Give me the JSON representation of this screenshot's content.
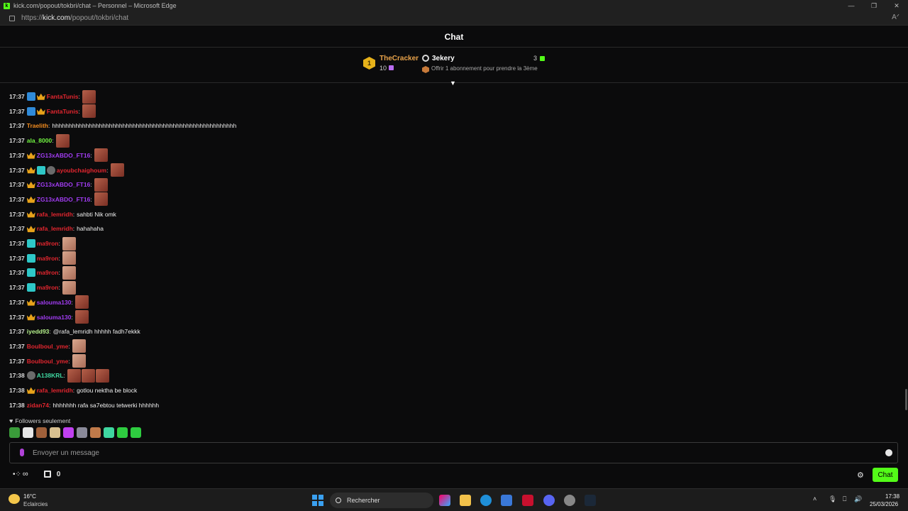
{
  "window": {
    "title": "kick.com/popout/tokbri/chat – Personnel – Microsoft Edge",
    "url_prefix": "https://",
    "url_host": "kick.com",
    "url_path": "/popout/tokbri/chat"
  },
  "header": {
    "title": "Chat"
  },
  "leaderboard": {
    "rank": "1",
    "first_name": "TheCracker",
    "first_count": "10",
    "second_name": "3ekery",
    "second_count": "3",
    "hint": "Offrir 1 abonnement pour prendre la 3ème"
  },
  "messages": [
    {
      "time": "17:37",
      "badges": [
        "sub",
        "vip"
      ],
      "user": "FantaTunis",
      "color": "#e3262f",
      "text": "",
      "emotes": 1,
      "emote_style": "dark"
    },
    {
      "time": "17:37",
      "badges": [
        "sub",
        "vip"
      ],
      "user": "FantaTunis",
      "color": "#e3262f",
      "text": "",
      "emotes": 1,
      "emote_style": "dark"
    },
    {
      "time": "17:37",
      "badges": [],
      "user": "Traelith",
      "color": "#f28c1f",
      "text": "hhhhhhhhhhhhhhhhhhhhhhhhhhhhhhhhhhhhhhhhhhhhhhhhhhhhhhh",
      "emotes": 0,
      "emote_style": "dark"
    },
    {
      "time": "17:37",
      "badges": [],
      "user": "ala_8000",
      "color": "#72f542",
      "text": "",
      "emotes": 1,
      "emote_style": "dark"
    },
    {
      "time": "17:37",
      "badges": [
        "vip"
      ],
      "user": "ZG13xABDO_FT16",
      "color": "#a13cf2",
      "text": "",
      "emotes": 1,
      "emote_style": "dark"
    },
    {
      "time": "17:37",
      "badges": [
        "vip",
        "og",
        "av"
      ],
      "user": "ayoubchaighoum",
      "color": "#e3262f",
      "text": "",
      "emotes": 1,
      "emote_style": "dark"
    },
    {
      "time": "17:37",
      "badges": [
        "vip"
      ],
      "user": "ZG13xABDO_FT16",
      "color": "#a13cf2",
      "text": "",
      "emotes": 1,
      "emote_style": "dark"
    },
    {
      "time": "17:37",
      "badges": [
        "vip"
      ],
      "user": "ZG13xABDO_FT16",
      "color": "#a13cf2",
      "text": "",
      "emotes": 1,
      "emote_style": "dark"
    },
    {
      "time": "17:37",
      "badges": [
        "vip"
      ],
      "user": "rafa_lemridh",
      "color": "#e3262f",
      "text": "sahbti Nik omk",
      "emotes": 0,
      "emote_style": "dark"
    },
    {
      "time": "17:37",
      "badges": [
        "vip"
      ],
      "user": "rafa_lemridh",
      "color": "#e3262f",
      "text": "hahahaha",
      "emotes": 0,
      "emote_style": "dark"
    },
    {
      "time": "17:37",
      "badges": [
        "og"
      ],
      "user": "ma9ron",
      "color": "#e3262f",
      "text": "",
      "emotes": 1,
      "emote_style": "light"
    },
    {
      "time": "17:37",
      "badges": [
        "og"
      ],
      "user": "ma9ron",
      "color": "#e3262f",
      "text": "",
      "emotes": 1,
      "emote_style": "light"
    },
    {
      "time": "17:37",
      "badges": [
        "og"
      ],
      "user": "ma9ron",
      "color": "#e3262f",
      "text": "",
      "emotes": 1,
      "emote_style": "light"
    },
    {
      "time": "17:37",
      "badges": [
        "og"
      ],
      "user": "ma9ron",
      "color": "#e3262f",
      "text": "",
      "emotes": 1,
      "emote_style": "light"
    },
    {
      "time": "17:37",
      "badges": [
        "vip"
      ],
      "user": "salouma130",
      "color": "#a13cf2",
      "text": "",
      "emotes": 1,
      "emote_style": "dark"
    },
    {
      "time": "17:37",
      "badges": [
        "vip"
      ],
      "user": "salouma130",
      "color": "#a13cf2",
      "text": "",
      "emotes": 1,
      "emote_style": "dark"
    },
    {
      "time": "17:37",
      "badges": [],
      "user": "iyedd93",
      "color": "#b6f28c",
      "text": "@rafa_lemridh hhhhh fadh7ekkk",
      "emotes": 0,
      "emote_style": "dark"
    },
    {
      "time": "17:37",
      "badges": [],
      "user": "Boulboul_yme",
      "color": "#e3262f",
      "text": "",
      "emotes": 1,
      "emote_style": "light"
    },
    {
      "time": "17:37",
      "badges": [],
      "user": "Boulboul_yme",
      "color": "#e3262f",
      "text": "",
      "emotes": 1,
      "emote_style": "light"
    },
    {
      "time": "17:38",
      "badges": [
        "av"
      ],
      "user": "A138KRL",
      "color": "#3fd6a0",
      "text": "",
      "emotes": 3,
      "emote_style": "dark"
    },
    {
      "time": "17:38",
      "badges": [
        "vip"
      ],
      "user": "rafa_lemridh",
      "color": "#e3262f",
      "text": "gotlou nektha be block",
      "emotes": 0,
      "emote_style": "dark"
    },
    {
      "time": "17:38",
      "badges": [],
      "user": "zidan74",
      "color": "#e3262f",
      "text": "hhhhhhh rafa sa7ebtou tetwerki hhhhhh",
      "emotes": 0,
      "emote_style": "dark"
    }
  ],
  "footer": {
    "followers_label": "Followers seulement",
    "input_placeholder": "Envoyer un message",
    "points": "0",
    "chat_button": "Chat"
  },
  "emote_bar_colors": [
    "#3a9b3a",
    "#e6e6e6",
    "#a0603a",
    "#d8c090",
    "#c040f0",
    "#8a8a9a",
    "#c07a4a",
    "#3fd6a0",
    "#2ecc40",
    "#2ecc40"
  ],
  "taskbar": {
    "temp": "16°C",
    "weather": "Eclaircies",
    "search": "Rechercher",
    "time": "17:38",
    "date": "25/03/2026"
  },
  "colors": {
    "accent": "#53fc18"
  }
}
